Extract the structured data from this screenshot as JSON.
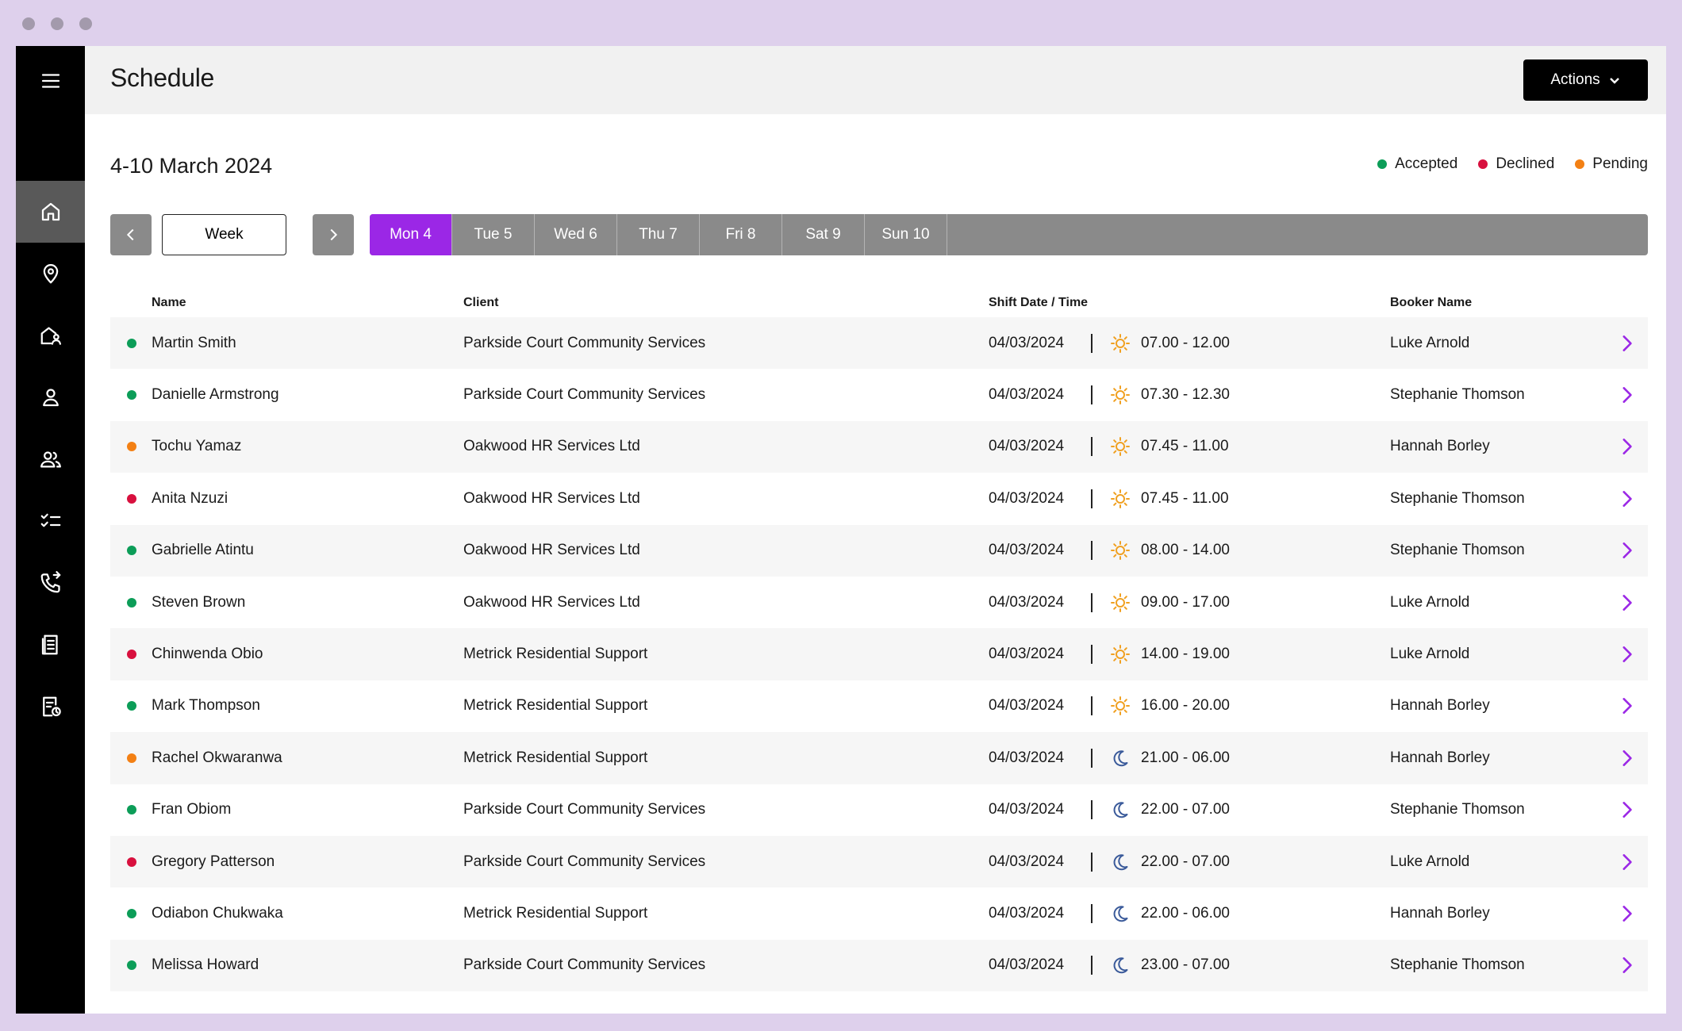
{
  "header": {
    "title": "Schedule",
    "actions_label": "Actions"
  },
  "range_title": "4-10 March 2024",
  "legend": [
    {
      "label": "Accepted",
      "color": "#0c9d58"
    },
    {
      "label": "Declined",
      "color": "#d8103e"
    },
    {
      "label": "Pending",
      "color": "#f38014"
    }
  ],
  "controls": {
    "view_label": "Week"
  },
  "days": [
    "Mon 4",
    "Tue 5",
    "Wed 6",
    "Thu 7",
    "Fri 8",
    "Sat 9",
    "Sun 10"
  ],
  "active_day": "Mon 4",
  "sidebar": {
    "items": [
      {
        "icon": "home-icon",
        "active": true
      },
      {
        "icon": "location-pin-icon",
        "active": false
      },
      {
        "icon": "building-user-icon",
        "active": false
      },
      {
        "icon": "user-icon",
        "active": false
      },
      {
        "icon": "users-icon",
        "active": false
      },
      {
        "icon": "checklist-icon",
        "active": false
      },
      {
        "icon": "phone-forward-icon",
        "active": false
      },
      {
        "icon": "document-icon",
        "active": false
      },
      {
        "icon": "timesheet-icon",
        "active": false
      }
    ]
  },
  "table": {
    "columns": {
      "name": "Name",
      "client": "Client",
      "shift": "Shift Date / Time",
      "booker": "Booker Name"
    },
    "rows": [
      {
        "status": "accepted",
        "name": "Martin Smith",
        "client": "Parkside Court Community Services",
        "date": "04/03/2024",
        "shift_type": "day",
        "time": "07.00 - 12.00",
        "booker": "Luke Arnold"
      },
      {
        "status": "accepted",
        "name": "Danielle Armstrong",
        "client": "Parkside Court Community Services",
        "date": "04/03/2024",
        "shift_type": "day",
        "time": "07.30 - 12.30",
        "booker": "Stephanie Thomson"
      },
      {
        "status": "pending",
        "name": "Tochu Yamaz",
        "client": "Oakwood HR Services Ltd",
        "date": "04/03/2024",
        "shift_type": "day",
        "time": "07.45 - 11.00",
        "booker": "Hannah Borley"
      },
      {
        "status": "declined",
        "name": "Anita Nzuzi",
        "client": "Oakwood HR Services Ltd",
        "date": "04/03/2024",
        "shift_type": "day",
        "time": "07.45 - 11.00",
        "booker": "Stephanie Thomson"
      },
      {
        "status": "accepted",
        "name": "Gabrielle Atintu",
        "client": "Oakwood HR Services Ltd",
        "date": "04/03/2024",
        "shift_type": "day",
        "time": "08.00 - 14.00",
        "booker": "Stephanie Thomson"
      },
      {
        "status": "accepted",
        "name": "Steven Brown",
        "client": "Oakwood HR Services Ltd",
        "date": "04/03/2024",
        "shift_type": "day",
        "time": "09.00 - 17.00",
        "booker": "Luke Arnold"
      },
      {
        "status": "declined",
        "name": "Chinwenda Obio",
        "client": "Metrick Residential Support",
        "date": "04/03/2024",
        "shift_type": "day",
        "time": "14.00 - 19.00",
        "booker": "Luke Arnold"
      },
      {
        "status": "accepted",
        "name": "Mark Thompson",
        "client": "Metrick Residential Support",
        "date": "04/03/2024",
        "shift_type": "day",
        "time": "16.00 - 20.00",
        "booker": "Hannah Borley"
      },
      {
        "status": "pending",
        "name": "Rachel Okwaranwa",
        "client": "Metrick Residential Support",
        "date": "04/03/2024",
        "shift_type": "night",
        "time": "21.00 - 06.00",
        "booker": "Hannah Borley"
      },
      {
        "status": "accepted",
        "name": "Fran Obiom",
        "client": "Parkside Court Community Services",
        "date": "04/03/2024",
        "shift_type": "night",
        "time": "22.00 - 07.00",
        "booker": "Stephanie Thomson"
      },
      {
        "status": "declined",
        "name": "Gregory Patterson",
        "client": "Parkside Court Community Services",
        "date": "04/03/2024",
        "shift_type": "night",
        "time": "22.00 - 07.00",
        "booker": "Luke Arnold"
      },
      {
        "status": "accepted",
        "name": "Odiabon Chukwaka",
        "client": "Metrick Residential Support",
        "date": "04/03/2024",
        "shift_type": "night",
        "time": "22.00 - 06.00",
        "booker": "Hannah Borley"
      },
      {
        "status": "accepted",
        "name": "Melissa Howard",
        "client": "Parkside Court Community Services",
        "date": "04/03/2024",
        "shift_type": "night",
        "time": "23.00 - 07.00",
        "booker": "Stephanie Thomson"
      }
    ]
  },
  "colors": {
    "accent": "#9b27e6",
    "accepted": "#0c9d58",
    "declined": "#d8103e",
    "pending": "#f38014",
    "sun": "#f0a020",
    "moon": "#3a5a9a"
  }
}
